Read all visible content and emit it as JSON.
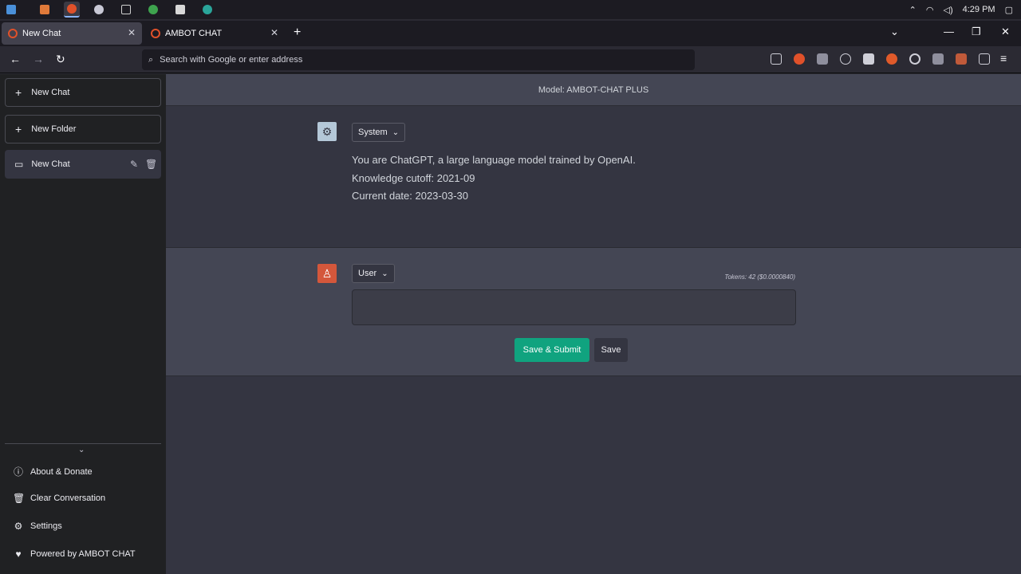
{
  "taskbar": {
    "apps": [
      {
        "icon": "start-icon",
        "color": "#4a90d9"
      },
      {
        "icon": "files-icon",
        "color": "#e07a3a"
      },
      {
        "icon": "firefox-icon",
        "color": "#e0512a"
      },
      {
        "icon": "globe-icon",
        "color": "#c9c9d6"
      },
      {
        "icon": "terminal-icon",
        "color": "#d0d0d0"
      },
      {
        "icon": "chrome-icon",
        "color": "#3ea34e"
      },
      {
        "icon": "notes-icon",
        "color": "#d8d8d8"
      },
      {
        "icon": "telegram-icon",
        "color": "#2aa59a"
      }
    ],
    "time": "4:29 PM"
  },
  "browser": {
    "tabs": [
      {
        "label": "New Chat",
        "active": true
      },
      {
        "label": "AMBOT CHAT",
        "active": false
      }
    ],
    "address_placeholder": "Search with Google or enter address"
  },
  "sidebar": {
    "new_chat_label": "New Chat",
    "new_folder_label": "New Folder",
    "chats": [
      {
        "label": "New Chat"
      }
    ],
    "footer": [
      {
        "label": "About & Donate",
        "icon": "info-icon"
      },
      {
        "label": "Clear Conversation",
        "icon": "trash-icon"
      },
      {
        "label": "Settings",
        "icon": "gear-icon"
      },
      {
        "label": "Powered by AMBOT CHAT",
        "icon": "heart-icon"
      }
    ]
  },
  "main": {
    "model_label": "Model: AMBOT-CHAT PLUS",
    "system": {
      "role": "System",
      "lines": [
        "You are ChatGPT, a large language model trained by OpenAI.",
        "Knowledge cutoff: 2021-09",
        "Current date: 2023-03-30"
      ]
    },
    "user": {
      "role": "User",
      "tokens": "Tokens: 42 ($0.0000840)",
      "input_value": "",
      "submit_label": "Save & Submit",
      "save_label": "Save"
    }
  },
  "colors": {
    "accent": "#10a37f",
    "user_avatar": "#d4573b",
    "system_avatar": "#b4c8d8"
  }
}
